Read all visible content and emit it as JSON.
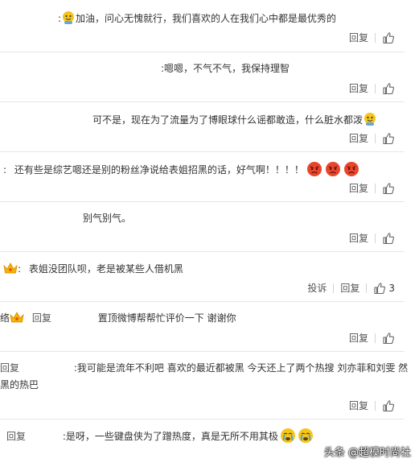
{
  "comments": [
    {
      "prefix": ":",
      "text": "加油，问心无愧就行，我们喜欢的人在我们心中都是最优秀的",
      "reply_label": "回复"
    },
    {
      "prefix": ":",
      "text": "嗯嗯，不气不气，我保持理智",
      "reply_label": "回复"
    },
    {
      "prefix": "",
      "text": "可不是，现在为了流量为了博眼球什么谣都敢造，什么脏水都泼",
      "reply_label": "回复"
    },
    {
      "prefix": ":",
      "text": "还有些是综艺嗯还是别的粉丝净说给表姐招黑的话，好气啊！！！！",
      "reply_label": "回复"
    },
    {
      "prefix": "",
      "text": "别气别气。",
      "reply_label": "回复"
    },
    {
      "prefix": ":",
      "text": "表姐没团队呗，老是被某些人借机黑",
      "report_label": "投诉",
      "reply_label": "回复",
      "like_count": "3"
    },
    {
      "lead": "络",
      "inline_reply": "回复",
      "text": "置顶微博帮帮忙评价一下 谢谢你",
      "reply_label": "回复"
    },
    {
      "lead": "回复",
      "text_line1": ":我可能是流年不利吧 喜欢的最近都被黑 今天还上了两个热搜 刘亦菲和刘雯 然",
      "text_line2": "黑的热巴",
      "reply_label": "回复"
    },
    {
      "lead": "回复",
      "text": ":是呀，一些键盘侠为了蹭热度，真是无所不用其极"
    }
  ],
  "watermark": "头条 @超模时尚社",
  "icons": {
    "like": "thumbs-up-icon",
    "emoji_face": "yellow-face-emoji",
    "angry": "angry-face-emoji",
    "crown": "crown-badge-icon",
    "cry": "crying-face-emoji"
  },
  "colors": {
    "text": "#333333",
    "action": "#555555",
    "divider": "#e6e6e6",
    "angry_red": "#e8452c"
  }
}
